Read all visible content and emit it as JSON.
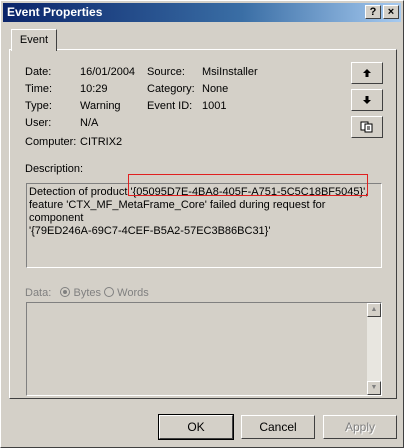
{
  "window": {
    "title": "Event Properties"
  },
  "titlebar": {
    "help_glyph": "?",
    "close_glyph": "×"
  },
  "tabs": [
    {
      "label": "Event"
    }
  ],
  "fields": {
    "date_label": "Date:",
    "date_value": "16/01/2004",
    "time_label": "Time:",
    "time_value": "10:29",
    "type_label": "Type:",
    "type_value": "Warning",
    "user_label": "User:",
    "user_value": "N/A",
    "computer_label": "Computer:",
    "computer_value": "CITRIX2",
    "source_label": "Source:",
    "source_value": "MsiInstaller",
    "category_label": "Category:",
    "category_value": "None",
    "eventid_label": "Event ID:",
    "eventid_value": "1001"
  },
  "description": {
    "label": "Description:",
    "line1_prefix": "Detection of product ",
    "line1_highlight": "'{05095D7E-4BA8-405F-A751-5C5C18BF5045}'",
    "line1_suffix": ",",
    "line2": "feature 'CTX_MF_MetaFrame_Core' failed during request for component",
    "line3": "'{79ED246A-69C7-4CEF-B5A2-57EC3B86BC31}'"
  },
  "data_section": {
    "label": "Data:",
    "option_bytes": "Bytes",
    "option_words": "Words",
    "selected": "Bytes"
  },
  "buttons": {
    "ok": "OK",
    "cancel": "Cancel",
    "apply": "Apply"
  },
  "icons": {
    "up": "arrow-up-icon",
    "down": "arrow-down-icon",
    "copy": "copy-icon"
  },
  "colors": {
    "titlebar_start": "#0a246a",
    "titlebar_end": "#a6caf0",
    "highlight": "#e02020",
    "face": "#d4d0c8"
  }
}
